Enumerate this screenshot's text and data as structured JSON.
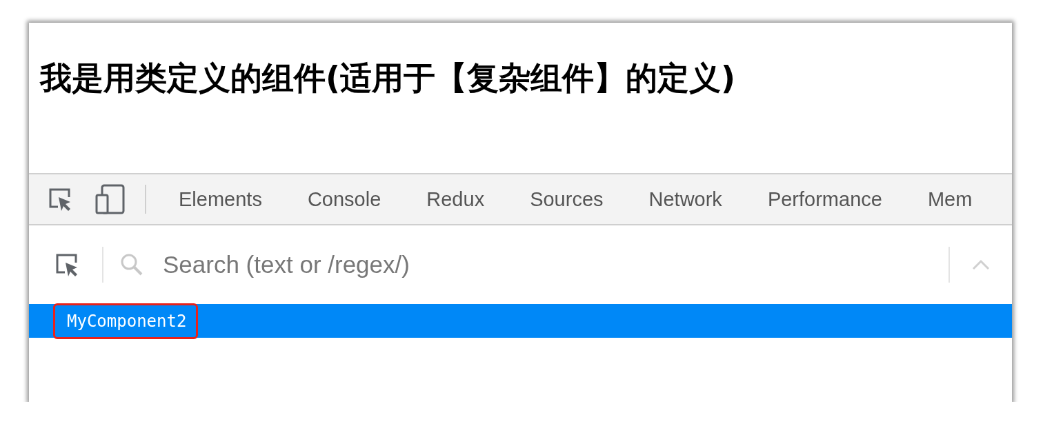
{
  "page": {
    "heading": "我是用类定义的组件(适用于【复杂组件】的定义)"
  },
  "devtools": {
    "tabs": [
      {
        "label": "Elements"
      },
      {
        "label": "Console"
      },
      {
        "label": "Redux"
      },
      {
        "label": "Sources"
      },
      {
        "label": "Network"
      },
      {
        "label": "Performance"
      },
      {
        "label": "Mem"
      }
    ],
    "search": {
      "placeholder": "Search (text or /regex/)"
    },
    "tree": [
      {
        "label": "MyComponent2",
        "selected": true,
        "outlined": true
      }
    ]
  }
}
